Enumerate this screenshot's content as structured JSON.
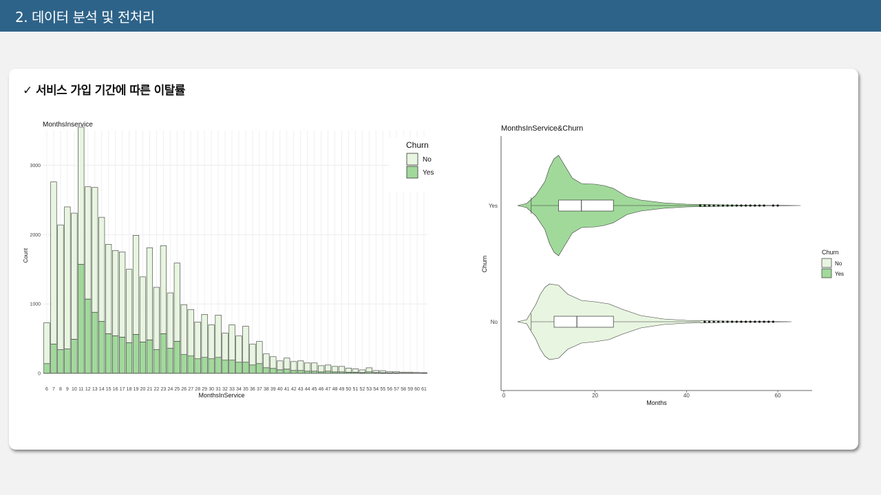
{
  "header": {
    "title": "2. 데이터 분석 및 전처리"
  },
  "section": {
    "title": "✓ 서비스 가입 기간에 따른 이탈률"
  },
  "colors": {
    "header_bg": "#2e6389",
    "no_fill": "#e8f5e0",
    "yes_fill": "#a1d99b",
    "outline": "#333333"
  },
  "chart_data": [
    {
      "type": "bar",
      "title": "MonthsInservice",
      "xlabel": "MonthsInService",
      "ylabel": "Count",
      "ylim": [
        0,
        3500
      ],
      "yticks": [
        0,
        1000,
        2000,
        3000
      ],
      "grid": true,
      "stacked": true,
      "legend": {
        "title": "Churn",
        "position": "top-right"
      },
      "categories": [
        "6",
        "7",
        "8",
        "9",
        "10",
        "11",
        "12",
        "13",
        "14",
        "15",
        "16",
        "17",
        "18",
        "19",
        "20",
        "21",
        "22",
        "23",
        "24",
        "25",
        "26",
        "27",
        "28",
        "29",
        "30",
        "31",
        "32",
        "33",
        "34",
        "35",
        "36",
        "37",
        "38",
        "39",
        "40",
        "41",
        "42",
        "43",
        "44",
        "45",
        "46",
        "47",
        "48",
        "49",
        "50",
        "51",
        "52",
        "53",
        "54",
        "55",
        "56",
        "57",
        "58",
        "59",
        "60",
        "61"
      ],
      "series": [
        {
          "name": "No",
          "values": [
            590,
            2340,
            1800,
            2050,
            1820,
            1980,
            1620,
            1800,
            1500,
            1290,
            1230,
            1230,
            1060,
            1430,
            940,
            1330,
            900,
            1270,
            800,
            1130,
            720,
            670,
            530,
            620,
            490,
            610,
            390,
            510,
            380,
            520,
            300,
            320,
            200,
            170,
            130,
            160,
            130,
            140,
            120,
            120,
            90,
            90,
            80,
            80,
            60,
            50,
            40,
            60,
            30,
            30,
            20,
            20,
            15,
            15,
            10,
            8
          ]
        },
        {
          "name": "Yes",
          "values": [
            140,
            420,
            340,
            350,
            490,
            1570,
            1070,
            880,
            750,
            570,
            540,
            520,
            440,
            560,
            450,
            480,
            340,
            570,
            360,
            460,
            270,
            250,
            210,
            230,
            210,
            230,
            190,
            190,
            160,
            160,
            120,
            140,
            80,
            70,
            50,
            60,
            40,
            40,
            30,
            30,
            20,
            30,
            20,
            20,
            15,
            15,
            10,
            20,
            10,
            8,
            5,
            5,
            3,
            3,
            2,
            2
          ]
        }
      ]
    },
    {
      "type": "violin",
      "title": "MonthsInService&Churn",
      "xlabel": "Months",
      "ylabel": "Churn",
      "xlim": [
        0,
        65
      ],
      "xticks": [
        0,
        20,
        40,
        60
      ],
      "categories": [
        "Yes",
        "No"
      ],
      "legend": {
        "title": "Churn",
        "position": "right",
        "items": [
          "No",
          "Yes"
        ]
      },
      "series": [
        {
          "name": "Yes",
          "min": 6,
          "q1": 12,
          "median": 17,
          "q3": 24,
          "whisker_max": 43,
          "outliers": [
            43,
            44,
            45,
            46,
            47,
            48,
            49,
            50,
            51,
            52,
            53,
            54,
            55,
            56,
            57,
            59,
            60
          ]
        },
        {
          "name": "No",
          "min": 6,
          "q1": 11,
          "median": 16,
          "q3": 24,
          "whisker_max": 43,
          "outliers": [
            44,
            45,
            46,
            47,
            48,
            49,
            50,
            51,
            52,
            53,
            54,
            55,
            56,
            57,
            58,
            59
          ]
        }
      ]
    }
  ]
}
